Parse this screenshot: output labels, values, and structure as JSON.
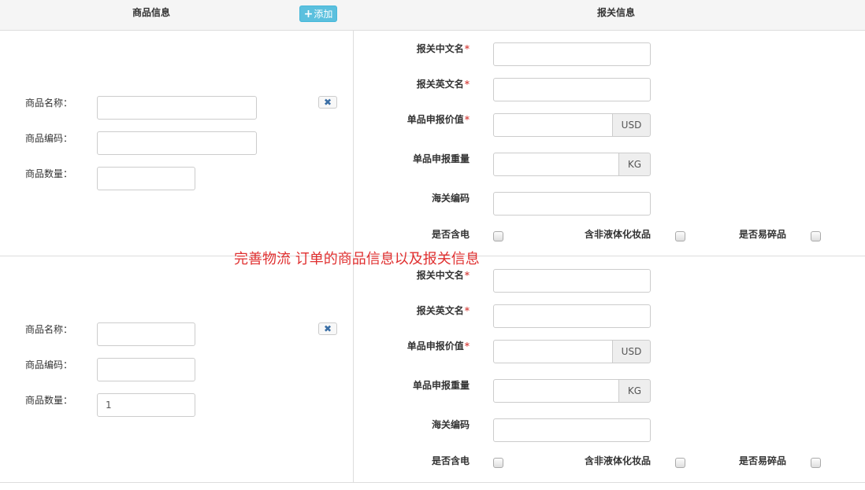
{
  "header": {
    "goods_title": "商品信息",
    "add_label": "添加",
    "customs_title": "报关信息"
  },
  "goods_labels": {
    "name": "商品名称：",
    "code": "商品编码：",
    "quantity": "商品数量："
  },
  "customs_labels": {
    "cn_name": "报关中文名",
    "en_name": "报关英文名",
    "unit_value": "单品申报价值",
    "unit_weight": "单品申报重量",
    "hs_code": "海关编码",
    "battery": "是否含电",
    "non_liquid": "含非液体化妆品",
    "fragile": "是否易碎品"
  },
  "required_mark": "*",
  "units": {
    "currency": "USD",
    "weight": "KG"
  },
  "items": [
    {
      "name": "",
      "code": "",
      "quantity": "",
      "cn_name": "",
      "en_name": "",
      "unit_value": "",
      "unit_weight": "",
      "hs_code": "",
      "battery": false,
      "non_liquid": false,
      "fragile": false
    },
    {
      "name": "",
      "code": "",
      "quantity": "1",
      "cn_name": "",
      "en_name": "",
      "unit_value": "",
      "unit_weight": "",
      "hs_code": "",
      "battery": false,
      "non_liquid": false,
      "fragile": false
    }
  ],
  "overlay_note": "完善物流 订单的商品信息以及报关信息"
}
